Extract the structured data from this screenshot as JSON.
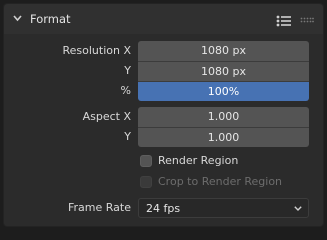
{
  "panel": {
    "title": "Format",
    "icons": [
      "chevron-down-icon",
      "list-icon",
      "drag-grip-icon"
    ]
  },
  "resolution": {
    "label_x": "Resolution X",
    "label_y": "Y",
    "label_pct": "%",
    "x": "1080 px",
    "y": "1080 px",
    "percent": "100%",
    "percent_fill": 1.0
  },
  "aspect": {
    "label_x": "Aspect X",
    "label_y": "Y",
    "x": "1.000",
    "y": "1.000"
  },
  "render_region": {
    "label": "Render Region",
    "checked": false
  },
  "crop_region": {
    "label": "Crop to Render Region",
    "checked": false,
    "enabled": false
  },
  "frame_rate": {
    "label": "Frame Rate",
    "value": "24 fps"
  },
  "colors": {
    "accent": "#4772b3",
    "field": "#545454",
    "panel": "#2b2b2b"
  }
}
